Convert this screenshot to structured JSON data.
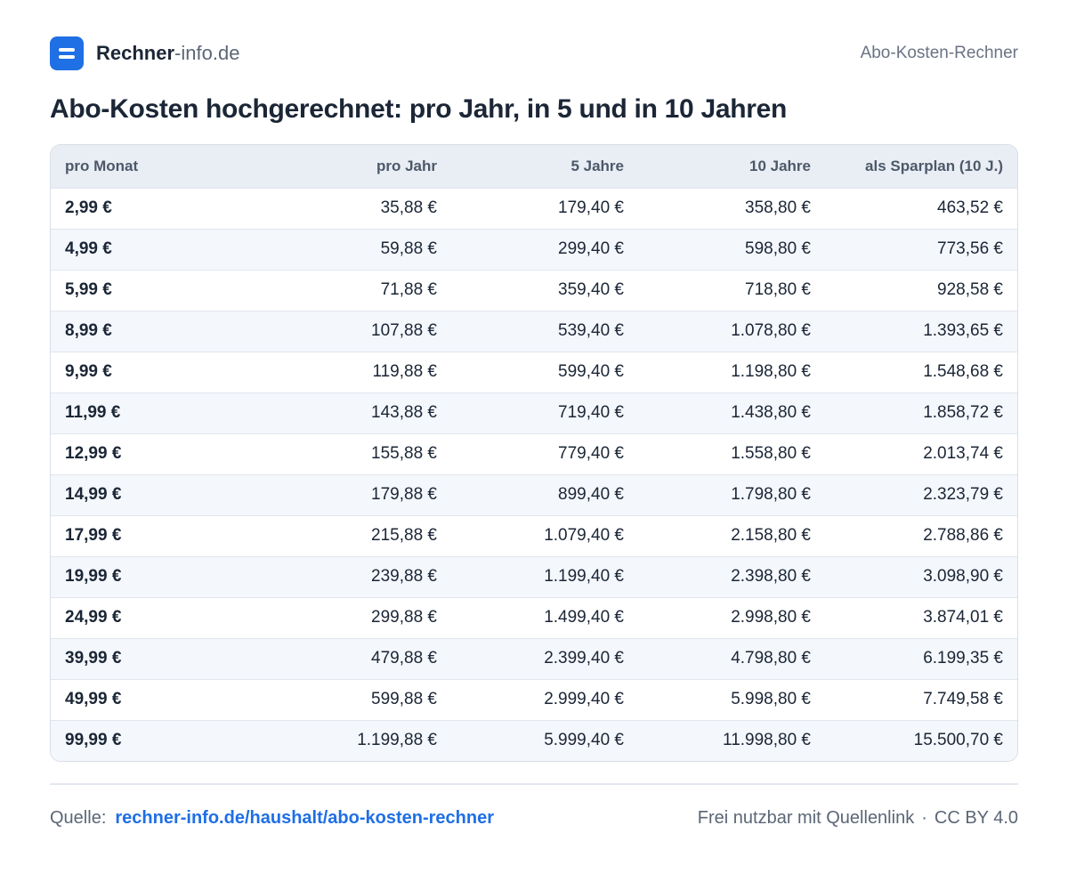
{
  "header": {
    "brand_name": "Rechner",
    "brand_suffix": "-info.de",
    "page_label": "Abo-Kosten-Rechner"
  },
  "title": "Abo-Kosten hochgerechnet: pro Jahr, in 5 und in 10 Jahren",
  "table": {
    "columns": [
      "pro Monat",
      "pro Jahr",
      "5 Jahre",
      "10 Jahre",
      "als Sparplan (10 J.)"
    ],
    "rows": [
      [
        "2,99 €",
        "35,88 €",
        "179,40 €",
        "358,80 €",
        "463,52 €"
      ],
      [
        "4,99 €",
        "59,88 €",
        "299,40 €",
        "598,80 €",
        "773,56 €"
      ],
      [
        "5,99 €",
        "71,88 €",
        "359,40 €",
        "718,80 €",
        "928,58 €"
      ],
      [
        "8,99 €",
        "107,88 €",
        "539,40 €",
        "1.078,80 €",
        "1.393,65 €"
      ],
      [
        "9,99 €",
        "119,88 €",
        "599,40 €",
        "1.198,80 €",
        "1.548,68 €"
      ],
      [
        "11,99 €",
        "143,88 €",
        "719,40 €",
        "1.438,80 €",
        "1.858,72 €"
      ],
      [
        "12,99 €",
        "155,88 €",
        "779,40 €",
        "1.558,80 €",
        "2.013,74 €"
      ],
      [
        "14,99 €",
        "179,88 €",
        "899,40 €",
        "1.798,80 €",
        "2.323,79 €"
      ],
      [
        "17,99 €",
        "215,88 €",
        "1.079,40 €",
        "2.158,80 €",
        "2.788,86 €"
      ],
      [
        "19,99 €",
        "239,88 €",
        "1.199,40 €",
        "2.398,80 €",
        "3.098,90 €"
      ],
      [
        "24,99 €",
        "299,88 €",
        "1.499,40 €",
        "2.998,80 €",
        "3.874,01 €"
      ],
      [
        "39,99 €",
        "479,88 €",
        "2.399,40 €",
        "4.798,80 €",
        "6.199,35 €"
      ],
      [
        "49,99 €",
        "599,88 €",
        "2.999,40 €",
        "5.998,80 €",
        "7.749,58 €"
      ],
      [
        "99,99 €",
        "1.199,88 €",
        "5.999,40 €",
        "11.998,80 €",
        "15.500,70 €"
      ]
    ]
  },
  "footer": {
    "source_label": "Quelle:",
    "source_link": "rechner-info.de/haushalt/abo-kosten-rechner",
    "usage": "Frei nutzbar mit Quellenlink",
    "separator": "·",
    "license": "CC BY 4.0"
  },
  "colors": {
    "accent": "#1f6fe5",
    "text": "#1b2636",
    "muted": "#5b6676",
    "header_bg": "#e9eef5",
    "row_alt_bg": "#f4f7fb"
  },
  "icons": {
    "logo": "equals-icon"
  }
}
